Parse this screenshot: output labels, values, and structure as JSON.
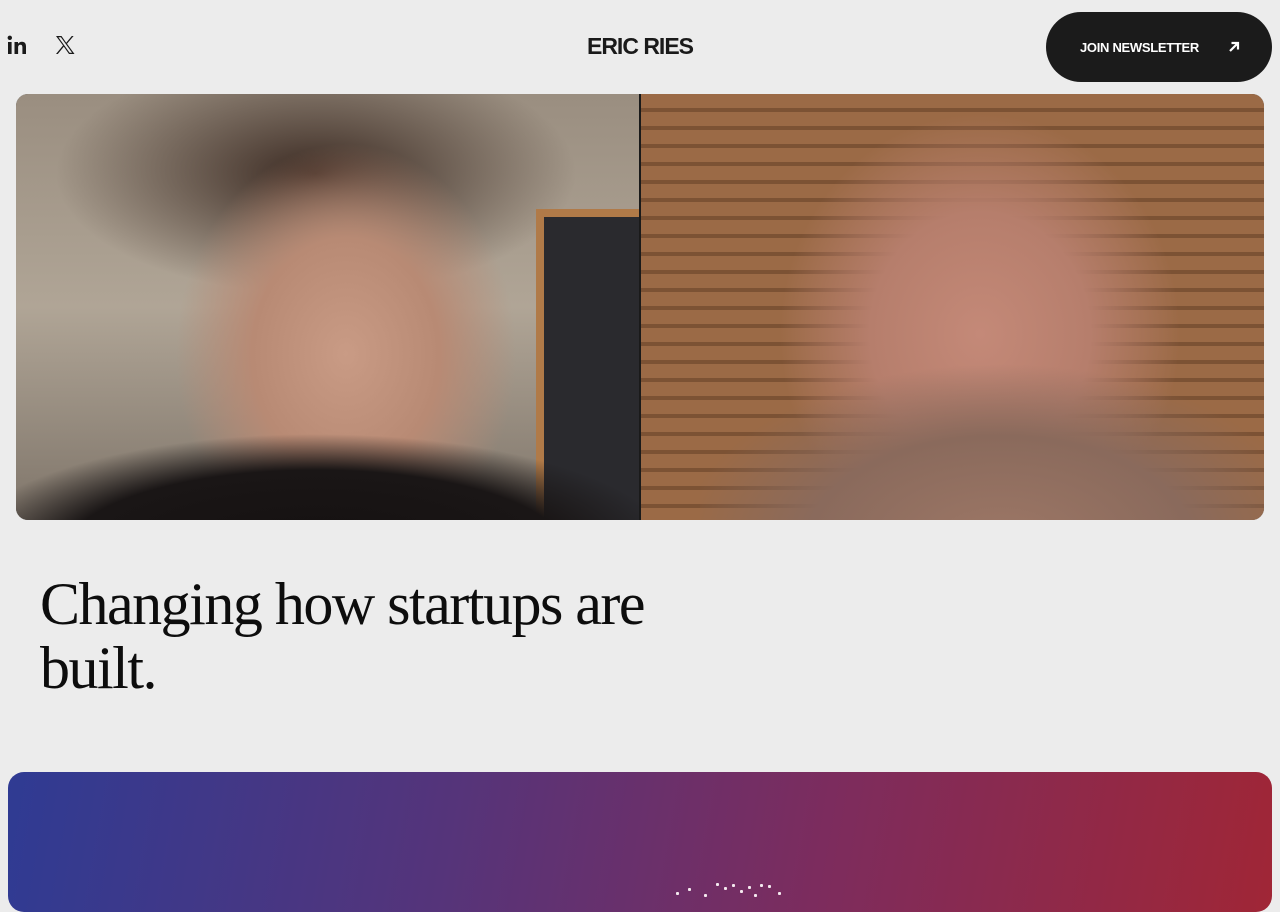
{
  "header": {
    "social": [
      {
        "icon": "linkedin-icon",
        "label": "in"
      },
      {
        "icon": "x-icon",
        "label": "𝕏"
      }
    ],
    "logo": "ERIC RIES",
    "newsletter_button": {
      "label": "JOIN NEWSLETTER",
      "icon": "arrow-up-right-icon"
    }
  },
  "hero": {
    "headline": "Changing how startups are built."
  },
  "colors": {
    "background": "#ececec",
    "button": "#1b1b1b",
    "gradient_start": "#2f3b93",
    "gradient_end": "#a02636"
  }
}
